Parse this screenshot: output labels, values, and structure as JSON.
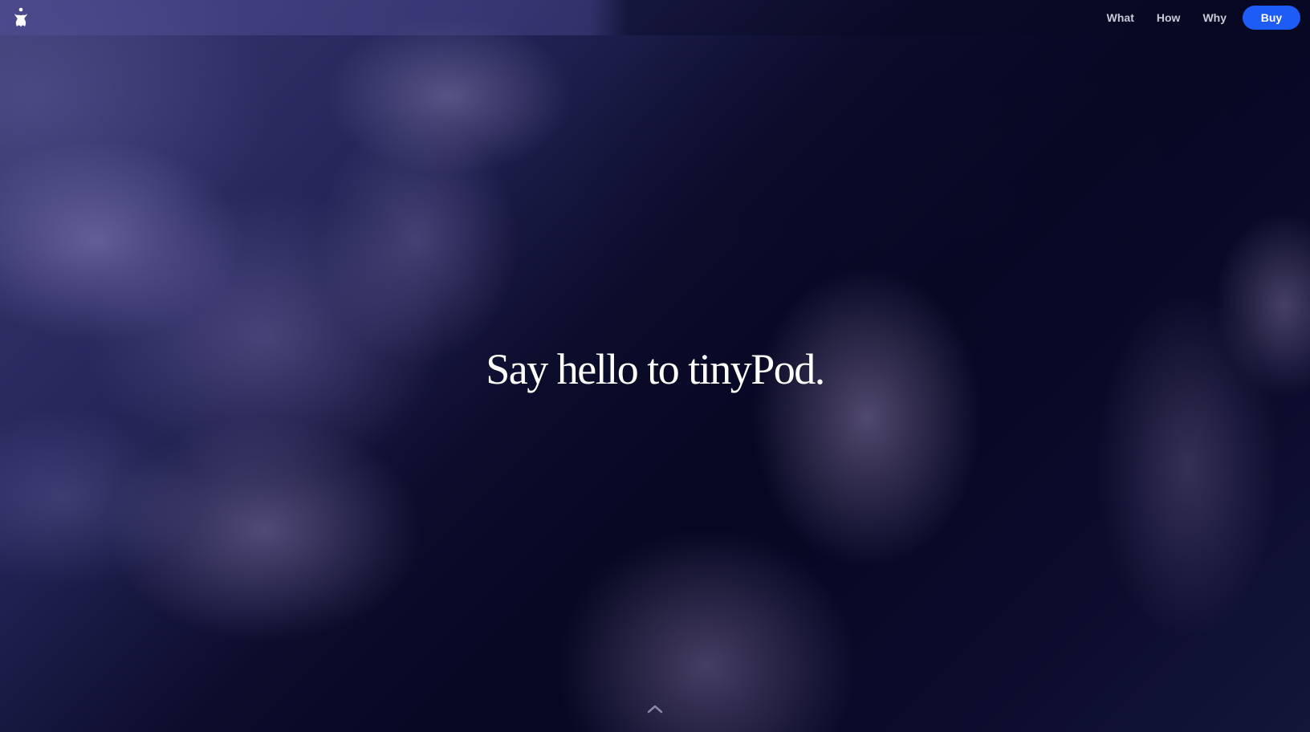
{
  "nav": {
    "logo_icon": "tinypod-logo-icon",
    "links": [
      {
        "label": "What"
      },
      {
        "label": "How"
      },
      {
        "label": "Why"
      }
    ],
    "buy_label": "Buy",
    "buy_color": "#1d5cf5"
  },
  "hero": {
    "title": "Say hello to tinyPod.",
    "background": "night-sky-clouds",
    "scroll_icon": "chevron-up-icon"
  }
}
